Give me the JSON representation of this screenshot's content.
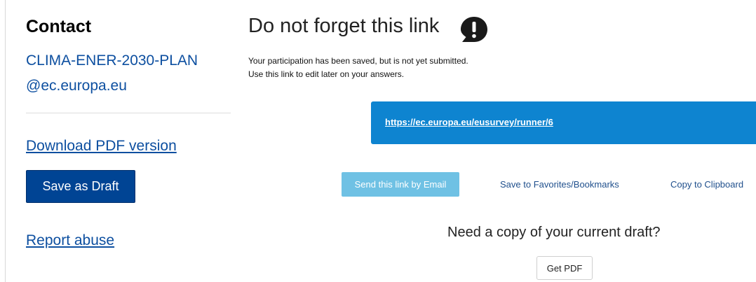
{
  "sidebar": {
    "contact_title": "Contact",
    "contact_email": "CLIMA-ENER-2030-PLAN@ec.europa.eu",
    "download_pdf": "Download PDF version",
    "save_draft": "Save as Draft",
    "report_abuse": "Report abuse"
  },
  "main": {
    "title": "Do not forget this link",
    "info_line1": "Your participation has been saved, but is not yet submitted.",
    "info_line2": "Use this link to edit later on your answers.",
    "link_url": "https://ec.europa.eu/eusurvey/runner/6",
    "send_email": "Send this link by Email",
    "save_favorites": "Save to Favorites/Bookmarks",
    "copy_clipboard": "Copy to Clipboard",
    "draft_question": "Need a copy of your current draft?",
    "get_pdf": "Get PDF"
  },
  "colors": {
    "link_blue": "#0d4fa0",
    "primary_button": "#004494",
    "link_box": "#0e84d0",
    "email_button": "#6fc1e4"
  },
  "icons": {
    "warning": "exclamation-speech-bubble-icon"
  }
}
